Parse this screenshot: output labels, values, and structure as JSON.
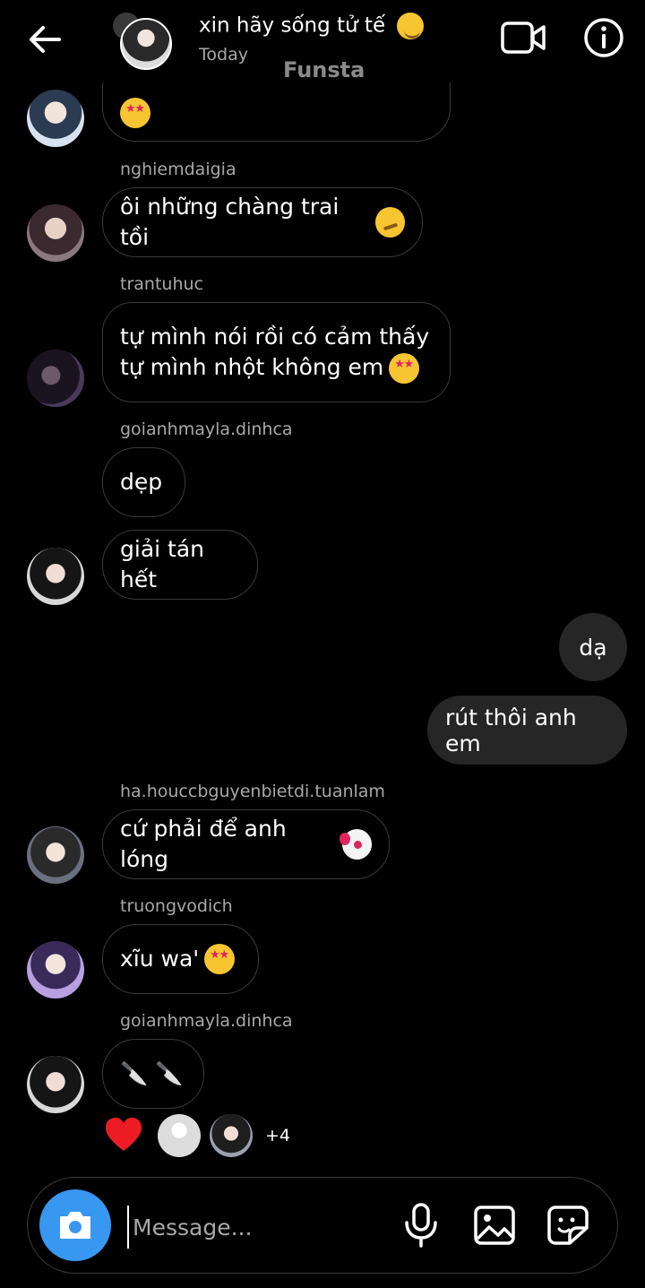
{
  "header": {
    "title": "xin hãy sống tử tế",
    "title_emoji": "smiling-blush-emoji",
    "subtitle": "Today",
    "watermark": "Funsta",
    "icons": [
      "back-arrow-icon",
      "video-call-icon",
      "info-icon"
    ]
  },
  "messages": [
    {
      "sender": "",
      "text": "",
      "emoji": "star-struck-emoji",
      "partial": true
    },
    {
      "sender": "nghiemdaigia",
      "text": "ôi những chàng trai tồi",
      "emoji": "woozy-emoji"
    },
    {
      "sender": "trantuhuc",
      "lines": [
        "tự mình nói rồi có cảm thấy",
        "tự mình nhột không em"
      ],
      "emoji": "star-struck-emoji"
    },
    {
      "sender": "goianhmayla.dinhca",
      "text": "dẹp"
    },
    {
      "sender": "",
      "text": "giải tán hết"
    },
    {
      "mine": true,
      "text": "dạ"
    },
    {
      "mine": true,
      "text": "rút thôi anh em"
    },
    {
      "sender": "ha.houccbguyenbietdi.tuanlam",
      "text": "cứ phải để anh lóng",
      "emoji": "clown-emoji"
    },
    {
      "sender": "truongvodich",
      "text": "xĩu wa'",
      "emoji": "star-struck-emoji"
    },
    {
      "sender": "goianhmayla.dinhca",
      "text": "🔪 🔪"
    }
  ],
  "reactions": {
    "emoji": "heart-icon",
    "more": "+4"
  },
  "composer": {
    "placeholder": "Message..."
  },
  "colors": {
    "background": "#000000",
    "accent": "#3897f0",
    "bubble_border": "#3a3a3a",
    "mine_bubble": "#262626",
    "secondary_text": "#a8a8a8",
    "heart": "#ed1c24"
  }
}
